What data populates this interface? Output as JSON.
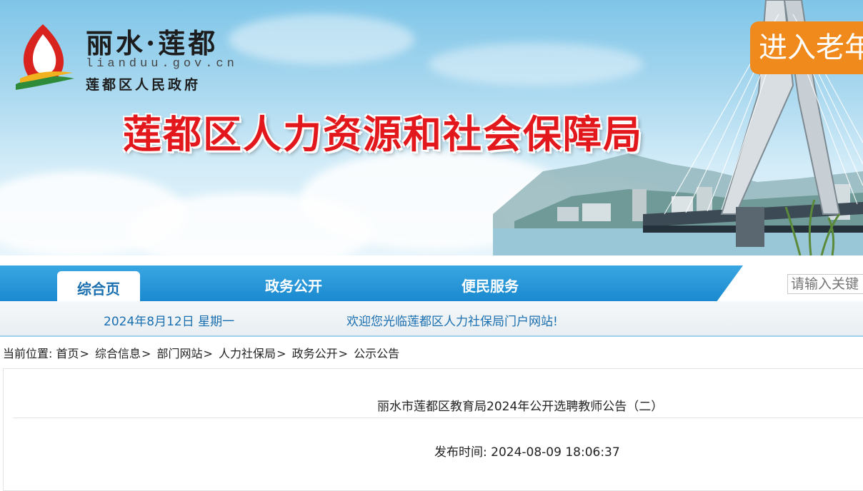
{
  "header": {
    "logo_title": "丽水·莲都",
    "logo_domain": "lianduu.gov.cn",
    "logo_subtitle": "莲都区人民政府",
    "site_title": "莲都区人力资源和社会保障局",
    "elder_mode_label": "进入老年"
  },
  "nav": {
    "items": [
      {
        "label": "综合页",
        "active": true
      },
      {
        "label": "政务公开"
      },
      {
        "label": "便民服务"
      }
    ],
    "search_placeholder": "请输入关键"
  },
  "info_bar": {
    "date": "2024年8月12日 星期一",
    "welcome": "欢迎您光临莲都区人力社保局门户网站!"
  },
  "breadcrumb": {
    "prefix": "当前位置:",
    "items": [
      "首页",
      "综合信息",
      "部门网站",
      "人力社保局",
      "政务公开",
      "公示公告"
    ],
    "separator": ">"
  },
  "article": {
    "title": "丽水市莲都区教育局2024年公开选聘教师公告（二）",
    "publish_time": "发布时间: 2024-08-09 18:06:37"
  },
  "colors": {
    "nav_blue": "#1a89cf",
    "title_red": "#e2181c",
    "elder_orange": "#f08a1d",
    "link_blue": "#1a6fb0"
  }
}
